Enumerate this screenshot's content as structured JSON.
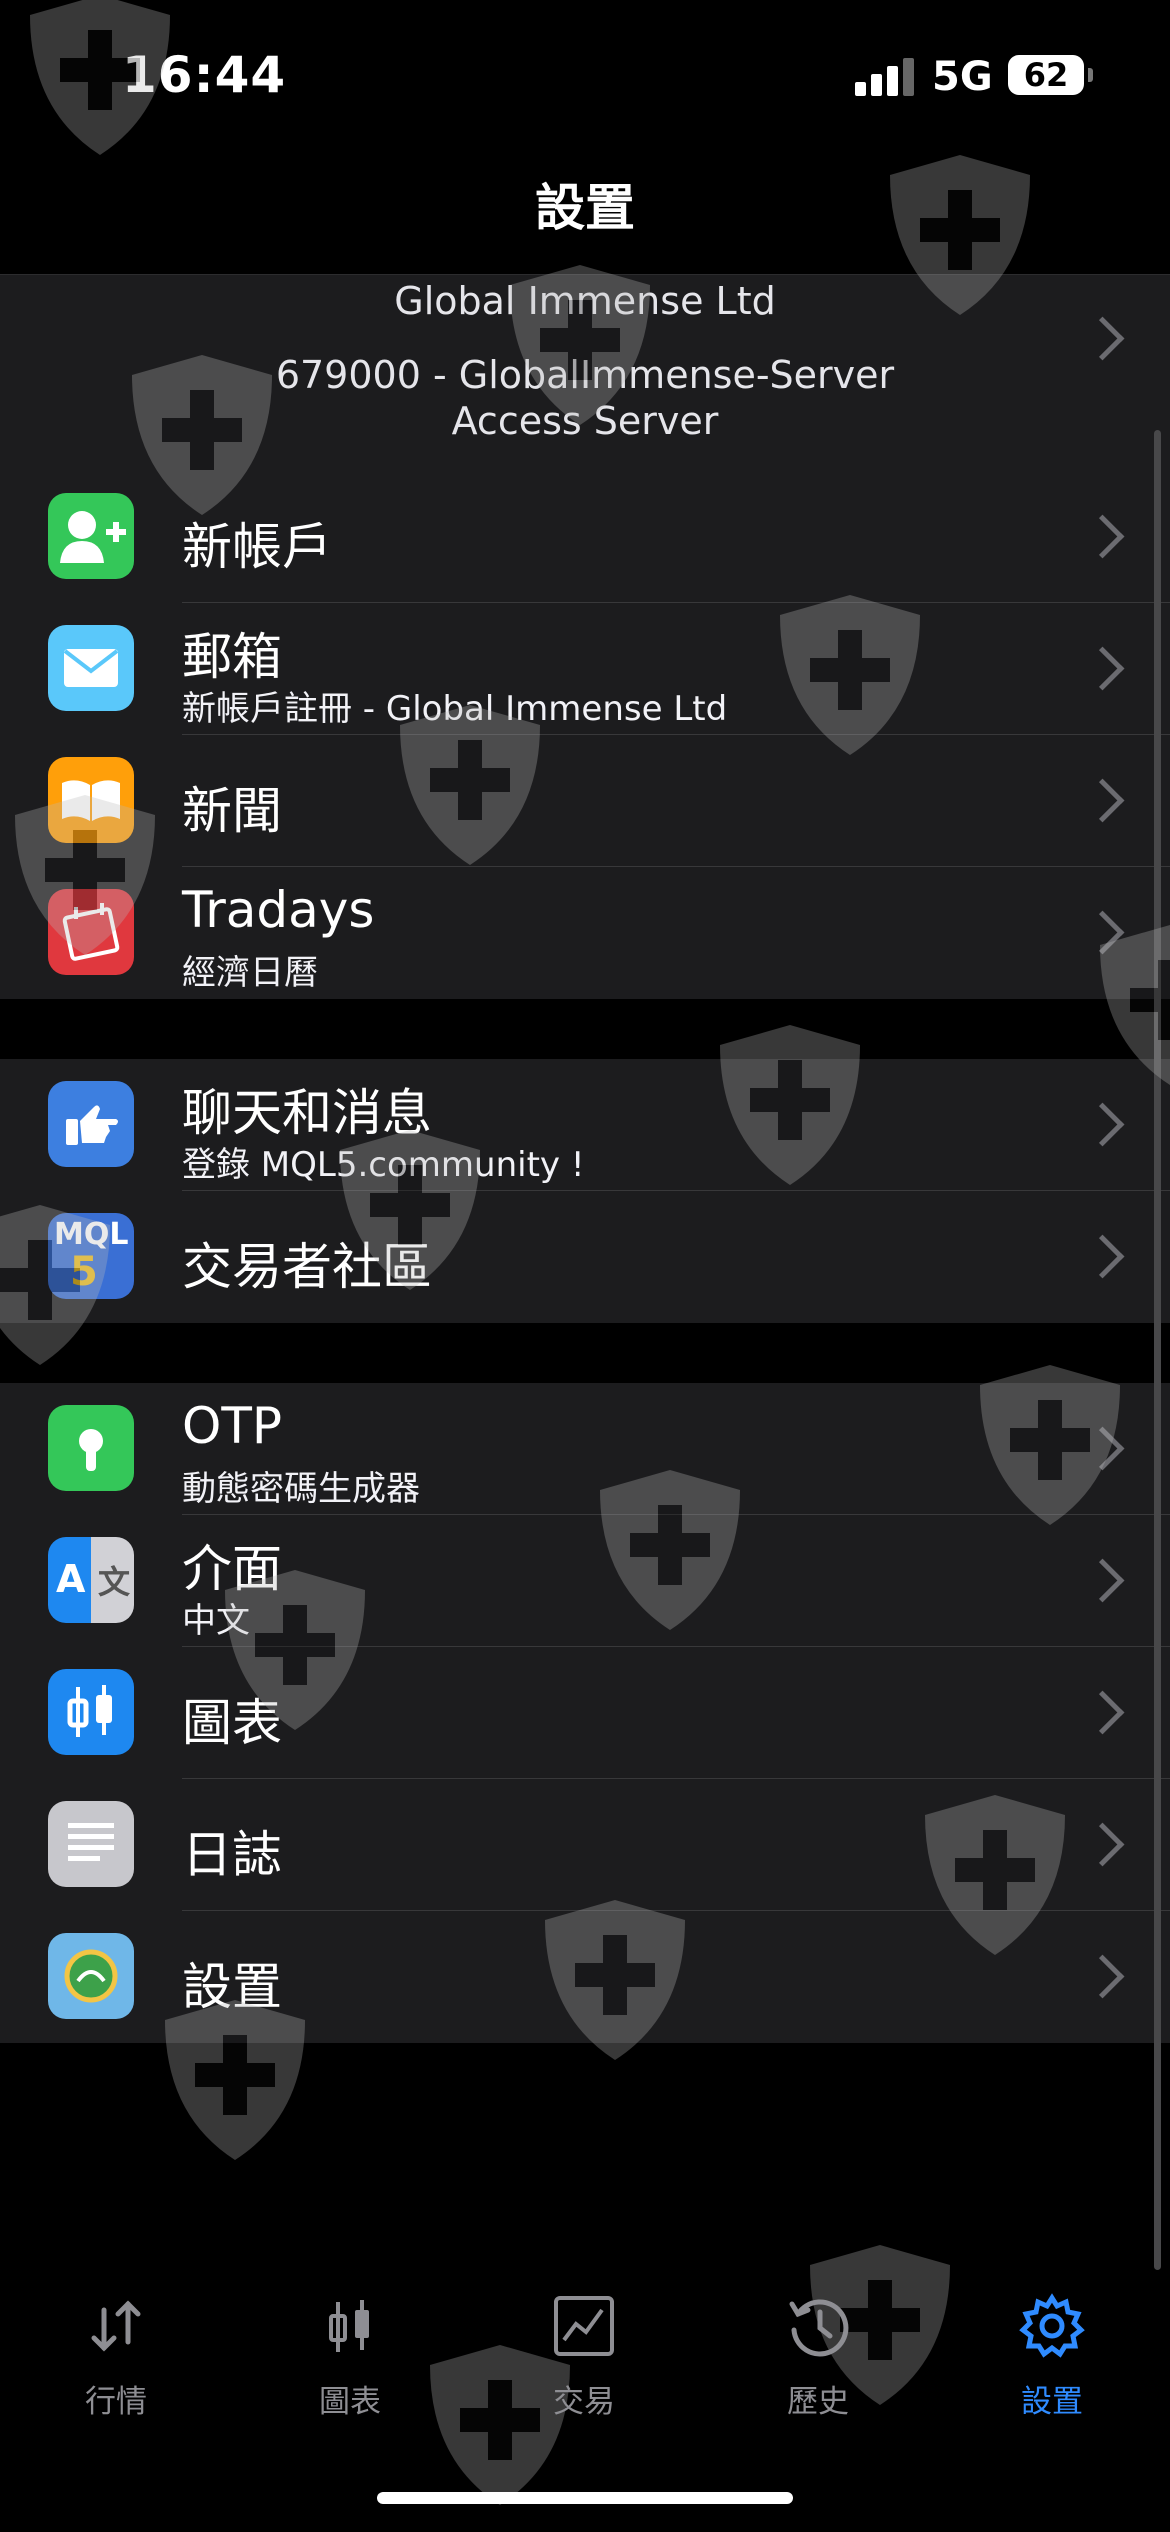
{
  "status_bar": {
    "time": "16:44",
    "network": "5G",
    "battery": "62"
  },
  "nav": {
    "title": "設置"
  },
  "account": {
    "company": "Global Immense Ltd",
    "login_server": "679000 - GlobalImmense-Server",
    "server_type": "Access Server"
  },
  "sections": [
    {
      "items": [
        {
          "title": "新帳戶",
          "subtitle": "",
          "icon": "add-user-icon",
          "color": "#34c759"
        },
        {
          "title": "郵箱",
          "subtitle": "新帳戶註冊 - Global Immense Ltd",
          "icon": "mail-icon",
          "color": "#5ac8fa"
        },
        {
          "title": "新聞",
          "subtitle": "",
          "icon": "book-icon",
          "color": "#ff9f0a"
        },
        {
          "title": "Tradays",
          "subtitle": "經濟日曆",
          "icon": "calendar-icon",
          "color": "#e0383e"
        }
      ]
    },
    {
      "items": [
        {
          "title": "聊天和消息",
          "subtitle": "登錄 MQL5.community !",
          "icon": "pointing-hand-icon",
          "color": "#3d7fe0"
        },
        {
          "title": "交易者社區",
          "subtitle": "",
          "icon": "mql5-icon",
          "color": "#3a6fd4",
          "icon_text": "MQL"
        }
      ]
    },
    {
      "items": [
        {
          "title": "OTP",
          "subtitle": "動態密碼生成器",
          "icon": "keyhole-icon",
          "color": "#34c759"
        },
        {
          "title": "介面",
          "subtitle": "中文",
          "icon": "translate-icon",
          "color": "#1e88f0",
          "icon_text": "A"
        },
        {
          "title": "圖表",
          "subtitle": "",
          "icon": "candlestick-icon",
          "color": "#1e88f0"
        },
        {
          "title": "日誌",
          "subtitle": "",
          "icon": "document-lines-icon",
          "color": "#c7c7cc"
        },
        {
          "title": "設置",
          "subtitle": "",
          "icon": "metatrader-logo-icon",
          "color": "#6fb7e8"
        }
      ]
    }
  ],
  "tabs": [
    {
      "label": "行情",
      "icon": "quotes-arrows-icon",
      "active": false
    },
    {
      "label": "圖表",
      "icon": "chart-candles-icon",
      "active": false
    },
    {
      "label": "交易",
      "icon": "trade-chart-icon",
      "active": false
    },
    {
      "label": "歷史",
      "icon": "history-clock-icon",
      "active": false
    },
    {
      "label": "設置",
      "icon": "gear-icon",
      "active": true
    }
  ],
  "colors": {
    "background": "#000000",
    "cell": "#1c1c1e",
    "accent": "#2f8bff",
    "inactive_tab": "#8e8e93"
  }
}
